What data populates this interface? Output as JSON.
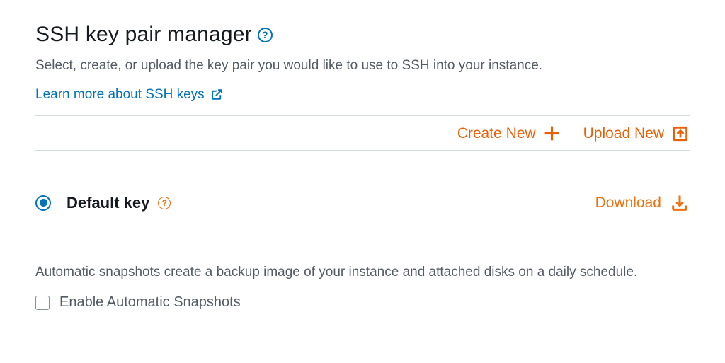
{
  "header": {
    "title": "SSH key pair manager",
    "description": "Select, create, or upload the key pair you would like to use to SSH into your instance.",
    "learn_more": "Learn more about SSH keys"
  },
  "actions": {
    "create": "Create New",
    "upload": "Upload New"
  },
  "keys": [
    {
      "name": "Default key",
      "selected": true,
      "download_label": "Download"
    }
  ],
  "snapshots": {
    "description": "Automatic snapshots create a backup image of your instance and attached disks on a daily schedule.",
    "checkbox_label": "Enable Automatic Snapshots",
    "enabled": false
  }
}
